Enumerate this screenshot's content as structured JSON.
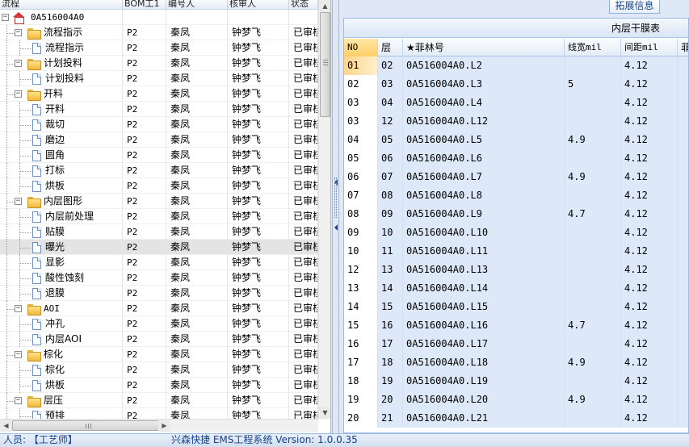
{
  "left_panel": {
    "columns": [
      "流程",
      "BOM工1",
      "编号人",
      "核审人",
      "状态"
    ],
    "rows": [
      {
        "label": "0A516004A0",
        "level": 0,
        "kind": "root",
        "expanded": true,
        "bom": "",
        "author": "",
        "reviewer": "",
        "status": ""
      },
      {
        "label": "流程指示",
        "level": 1,
        "kind": "folder",
        "expanded": true,
        "bom": "P2",
        "author": "秦凤",
        "reviewer": "钟梦飞",
        "status": "已审核"
      },
      {
        "label": "流程指示",
        "level": 2,
        "kind": "doc",
        "bom": "P2",
        "author": "秦凤",
        "reviewer": "钟梦飞",
        "status": "已审核"
      },
      {
        "label": "计划投料",
        "level": 1,
        "kind": "folder",
        "expanded": true,
        "bom": "P2",
        "author": "秦凤",
        "reviewer": "钟梦飞",
        "status": "已审核"
      },
      {
        "label": "计划投料",
        "level": 2,
        "kind": "doc",
        "bom": "P2",
        "author": "秦凤",
        "reviewer": "钟梦飞",
        "status": "已审核"
      },
      {
        "label": "开料",
        "level": 1,
        "kind": "folder",
        "expanded": true,
        "bom": "P2",
        "author": "秦凤",
        "reviewer": "钟梦飞",
        "status": "已审核"
      },
      {
        "label": "开料",
        "level": 2,
        "kind": "doc",
        "bom": "P2",
        "author": "秦凤",
        "reviewer": "钟梦飞",
        "status": "已审核"
      },
      {
        "label": "裁切",
        "level": 2,
        "kind": "doc",
        "bom": "P2",
        "author": "秦凤",
        "reviewer": "钟梦飞",
        "status": "已审核"
      },
      {
        "label": "磨边",
        "level": 2,
        "kind": "doc",
        "bom": "P2",
        "author": "秦凤",
        "reviewer": "钟梦飞",
        "status": "已审核"
      },
      {
        "label": "圆角",
        "level": 2,
        "kind": "doc",
        "bom": "P2",
        "author": "秦凤",
        "reviewer": "钟梦飞",
        "status": "已审核"
      },
      {
        "label": "打标",
        "level": 2,
        "kind": "doc",
        "bom": "P2",
        "author": "秦凤",
        "reviewer": "钟梦飞",
        "status": "已审核"
      },
      {
        "label": "烘板",
        "level": 2,
        "kind": "doc",
        "bom": "P2",
        "author": "秦凤",
        "reviewer": "钟梦飞",
        "status": "已审核"
      },
      {
        "label": "内层图形",
        "level": 1,
        "kind": "folder",
        "expanded": true,
        "bom": "P2",
        "author": "秦凤",
        "reviewer": "钟梦飞",
        "status": "已审核"
      },
      {
        "label": "内层前处理",
        "level": 2,
        "kind": "doc",
        "bom": "P2",
        "author": "秦凤",
        "reviewer": "钟梦飞",
        "status": "已审核"
      },
      {
        "label": "贴膜",
        "level": 2,
        "kind": "doc",
        "bom": "P2",
        "author": "秦凤",
        "reviewer": "钟梦飞",
        "status": "已审核"
      },
      {
        "label": "曝光",
        "level": 2,
        "kind": "doc",
        "selected": true,
        "bom": "P2",
        "author": "秦凤",
        "reviewer": "钟梦飞",
        "status": "已审核"
      },
      {
        "label": "显影",
        "level": 2,
        "kind": "doc",
        "bom": "P2",
        "author": "秦凤",
        "reviewer": "钟梦飞",
        "status": "已审核"
      },
      {
        "label": "酸性蚀刻",
        "level": 2,
        "kind": "doc",
        "bom": "P2",
        "author": "秦凤",
        "reviewer": "钟梦飞",
        "status": "已审核"
      },
      {
        "label": "退膜",
        "level": 2,
        "kind": "doc",
        "bom": "P2",
        "author": "秦凤",
        "reviewer": "钟梦飞",
        "status": "已审核"
      },
      {
        "label": "AOI",
        "level": 1,
        "kind": "folder",
        "expanded": true,
        "bom": "P2",
        "author": "秦凤",
        "reviewer": "钟梦飞",
        "status": "已审核"
      },
      {
        "label": "冲孔",
        "level": 2,
        "kind": "doc",
        "bom": "P2",
        "author": "秦凤",
        "reviewer": "钟梦飞",
        "status": "已审核"
      },
      {
        "label": "内层AOI",
        "level": 2,
        "kind": "doc",
        "bom": "P2",
        "author": "秦凤",
        "reviewer": "钟梦飞",
        "status": "已审核"
      },
      {
        "label": "棕化",
        "level": 1,
        "kind": "folder",
        "expanded": true,
        "bom": "P2",
        "author": "秦凤",
        "reviewer": "钟梦飞",
        "status": "已审核"
      },
      {
        "label": "棕化",
        "level": 2,
        "kind": "doc",
        "bom": "P2",
        "author": "秦凤",
        "reviewer": "钟梦飞",
        "status": "已审核"
      },
      {
        "label": "烘板",
        "level": 2,
        "kind": "doc",
        "bom": "P2",
        "author": "秦凤",
        "reviewer": "钟梦飞",
        "status": "已审核"
      },
      {
        "label": "层压",
        "level": 1,
        "kind": "folder",
        "expanded": true,
        "bom": "P2",
        "author": "秦凤",
        "reviewer": "钟梦飞",
        "status": "已审核"
      },
      {
        "label": "预排",
        "level": 2,
        "kind": "doc",
        "bom": "P2",
        "author": "秦凤",
        "reviewer": "钟梦飞",
        "status": "已审核"
      }
    ]
  },
  "right_panel": {
    "tab_label": "拓展信息",
    "grid_title": "内层干膜表",
    "columns": [
      "NO",
      "层",
      "★菲林号",
      "线宽mil",
      "间距mil",
      "菲"
    ],
    "rows": [
      {
        "no": "01",
        "layer": "02",
        "film": "0A516004A0.L2",
        "width": "",
        "spacing": "4.12",
        "selected": true
      },
      {
        "no": "02",
        "layer": "03",
        "film": "0A516004A0.L3",
        "width": "5",
        "spacing": "4.12"
      },
      {
        "no": "03",
        "layer": "04",
        "film": "0A516004A0.L4",
        "width": "",
        "spacing": "4.12"
      },
      {
        "no": "03",
        "layer": "12",
        "film": "0A516004A0.L12",
        "width": "",
        "spacing": "4.12"
      },
      {
        "no": "04",
        "layer": "05",
        "film": "0A516004A0.L5",
        "width": "4.9",
        "spacing": "4.12"
      },
      {
        "no": "05",
        "layer": "06",
        "film": "0A516004A0.L6",
        "width": "",
        "spacing": "4.12"
      },
      {
        "no": "06",
        "layer": "07",
        "film": "0A516004A0.L7",
        "width": "4.9",
        "spacing": "4.12"
      },
      {
        "no": "07",
        "layer": "08",
        "film": "0A516004A0.L8",
        "width": "",
        "spacing": "4.12"
      },
      {
        "no": "08",
        "layer": "09",
        "film": "0A516004A0.L9",
        "width": "4.7",
        "spacing": "4.12"
      },
      {
        "no": "09",
        "layer": "10",
        "film": "0A516004A0.L10",
        "width": "",
        "spacing": "4.12"
      },
      {
        "no": "10",
        "layer": "11",
        "film": "0A516004A0.L11",
        "width": "",
        "spacing": "4.12"
      },
      {
        "no": "12",
        "layer": "13",
        "film": "0A516004A0.L13",
        "width": "",
        "spacing": "4.12"
      },
      {
        "no": "13",
        "layer": "14",
        "film": "0A516004A0.L14",
        "width": "",
        "spacing": "4.12"
      },
      {
        "no": "14",
        "layer": "15",
        "film": "0A516004A0.L15",
        "width": "",
        "spacing": "4.12"
      },
      {
        "no": "15",
        "layer": "16",
        "film": "0A516004A0.L16",
        "width": "4.7",
        "spacing": "4.12"
      },
      {
        "no": "16",
        "layer": "17",
        "film": "0A516004A0.L17",
        "width": "",
        "spacing": "4.12"
      },
      {
        "no": "17",
        "layer": "18",
        "film": "0A516004A0.L18",
        "width": "4.9",
        "spacing": "4.12"
      },
      {
        "no": "18",
        "layer": "19",
        "film": "0A516004A0.L19",
        "width": "",
        "spacing": "4.12"
      },
      {
        "no": "19",
        "layer": "20",
        "film": "0A516004A0.L20",
        "width": "4.9",
        "spacing": "4.12"
      },
      {
        "no": "20",
        "layer": "21",
        "film": "0A516004A0.L21",
        "width": "",
        "spacing": "4.12"
      }
    ]
  },
  "status_bar": {
    "left": "人员: 【工艺师】",
    "center": "兴森快捷 EMS工程系统 Version: 1.0.0.35"
  },
  "colors": {
    "accent": "#15428b",
    "border": "#99bbe8",
    "cell_fill": "#dde9f8",
    "selected_row": "#ffd58a"
  },
  "icons": {
    "root": "home-icon",
    "folder": "folder-icon",
    "doc": "document-icon",
    "expander": "minus-box-icon"
  }
}
